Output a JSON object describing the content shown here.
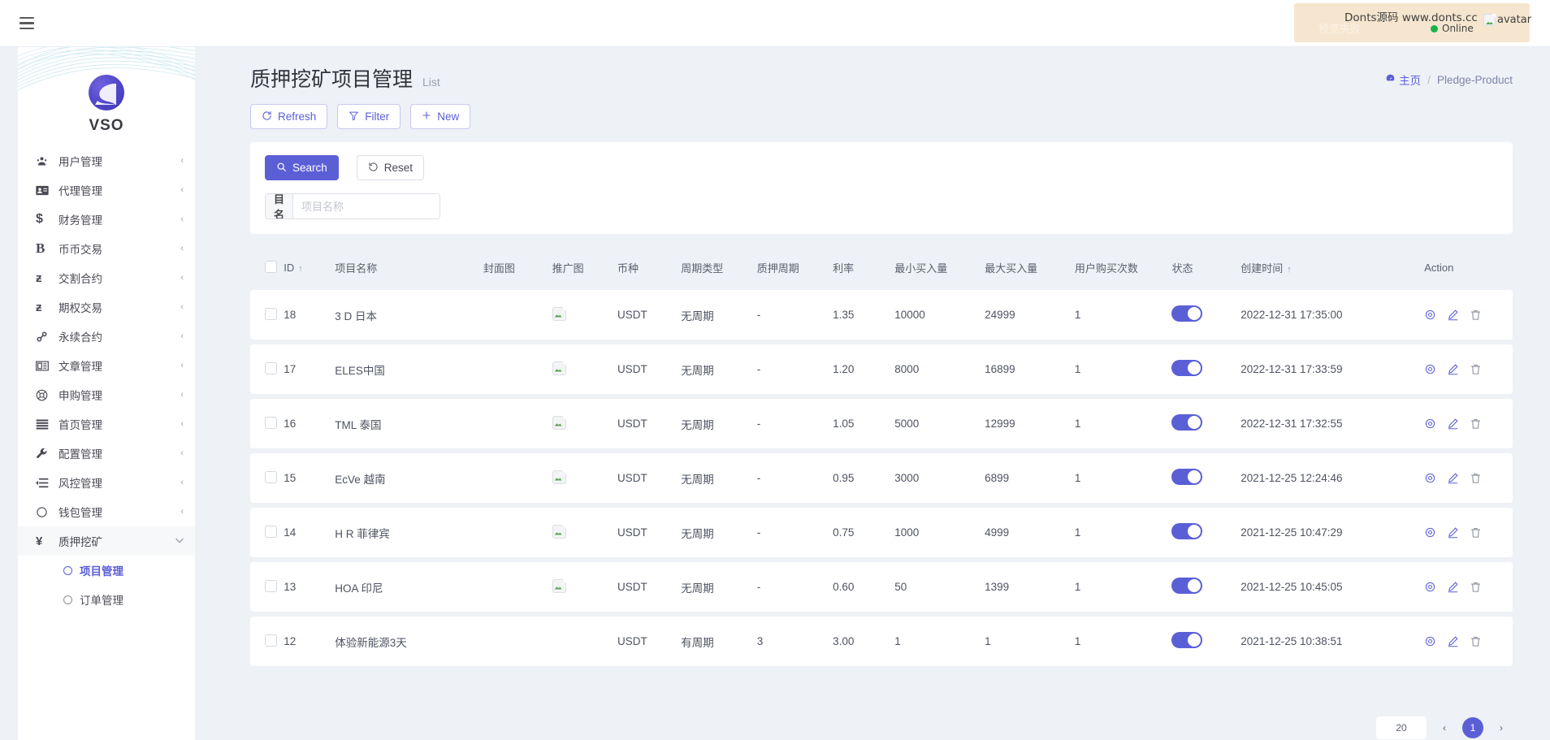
{
  "topbar": {
    "menu_toggle": "hamburger-menu",
    "notification_icon": "bell-icon",
    "theme_icon": "moon-icon"
  },
  "watermark": {
    "line1": "Donts源码 www.donts.cc",
    "fail_text": "预览失败",
    "online_label": "Online",
    "avatar_alt": "avatar"
  },
  "sidebar": {
    "brand": "VSO",
    "items": [
      {
        "label": "用户管理",
        "icon": "user-group-icon",
        "chevron": "‹"
      },
      {
        "label": "代理管理",
        "icon": "id-card-icon",
        "chevron": "‹"
      },
      {
        "label": "财务管理",
        "icon": "$",
        "chevron": "‹"
      },
      {
        "label": "币币交易",
        "icon": "B",
        "chevron": "‹"
      },
      {
        "label": "交割合约",
        "icon": "Ƀ",
        "chevron": "‹"
      },
      {
        "label": "期权交易",
        "icon": "Ƀ",
        "chevron": "‹"
      },
      {
        "label": "永续合约",
        "icon": "link-icon",
        "chevron": "‹"
      },
      {
        "label": "文章管理",
        "icon": "news-icon",
        "chevron": "‹"
      },
      {
        "label": "申购管理",
        "icon": "lifebuoy-icon",
        "chevron": "‹"
      },
      {
        "label": "首页管理",
        "icon": "lines-icon",
        "chevron": "‹"
      },
      {
        "label": "配置管理",
        "icon": "wrench-icon",
        "chevron": "‹"
      },
      {
        "label": "风控管理",
        "icon": "indent-icon",
        "chevron": "‹"
      },
      {
        "label": "钱包管理",
        "icon": "circle-icon",
        "chevron": "‹"
      }
    ],
    "active_group": {
      "label": "质押挖矿",
      "icon": "¥",
      "chevron": "⌄"
    },
    "submenu": [
      {
        "label": "项目管理",
        "current": true
      },
      {
        "label": "订单管理",
        "current": false
      }
    ]
  },
  "page": {
    "title": "质押挖矿项目管理",
    "subtitle": "List",
    "breadcrumb_home": "主页",
    "breadcrumb_sep": "/",
    "breadcrumb_current": "Pledge-Product"
  },
  "toolbar": {
    "refresh_label": "Refresh",
    "filter_label": "Filter",
    "new_label": "New"
  },
  "search_panel": {
    "search_label": "Search",
    "reset_label": "Reset",
    "field_label": "项目名称",
    "field_value": "",
    "field_placeholder": "项目名称"
  },
  "table": {
    "columns": [
      {
        "key": "cb",
        "label": "",
        "cls": "col-cb"
      },
      {
        "key": "id",
        "label": "ID",
        "cls": "col-id",
        "sort": "↑"
      },
      {
        "key": "name",
        "label": "项目名称",
        "cls": "col-name"
      },
      {
        "key": "cover",
        "label": "封面图",
        "cls": "col-cover"
      },
      {
        "key": "promo",
        "label": "推广图",
        "cls": "col-promo"
      },
      {
        "key": "coin",
        "label": "币种",
        "cls": "col-coin"
      },
      {
        "key": "cycle",
        "label": "周期类型",
        "cls": "col-cycle"
      },
      {
        "key": "period",
        "label": "质押周期",
        "cls": "col-period"
      },
      {
        "key": "rate",
        "label": "利率",
        "cls": "col-rate"
      },
      {
        "key": "min",
        "label": "最小买入量",
        "cls": "col-min"
      },
      {
        "key": "max",
        "label": "最大买入量",
        "cls": "col-max"
      },
      {
        "key": "times",
        "label": "用户购买次数",
        "cls": "col-times"
      },
      {
        "key": "status",
        "label": "状态",
        "cls": "col-status"
      },
      {
        "key": "time",
        "label": "创建时间",
        "cls": "col-time",
        "sort": "↑"
      },
      {
        "key": "action",
        "label": "Action",
        "cls": "col-action"
      }
    ],
    "rows": [
      {
        "id": "18",
        "name": "3 D 日本",
        "cover": "",
        "promo": "broken-image",
        "coin": "USDT",
        "cycle": "无周期",
        "period": "-",
        "rate": "1.35",
        "min": "10000",
        "max": "24999",
        "times": "1",
        "status": true,
        "time": "2022-12-31 17:35:00"
      },
      {
        "id": "17",
        "name": "ELES中国",
        "cover": "",
        "promo": "broken-image",
        "coin": "USDT",
        "cycle": "无周期",
        "period": "-",
        "rate": "1.20",
        "min": "8000",
        "max": "16899",
        "times": "1",
        "status": true,
        "time": "2022-12-31 17:33:59"
      },
      {
        "id": "16",
        "name": "TML 泰国",
        "cover": "",
        "promo": "broken-image",
        "coin": "USDT",
        "cycle": "无周期",
        "period": "-",
        "rate": "1.05",
        "min": "5000",
        "max": "12999",
        "times": "1",
        "status": true,
        "time": "2022-12-31 17:32:55"
      },
      {
        "id": "15",
        "name": "EcVe 越南",
        "cover": "",
        "promo": "broken-image",
        "coin": "USDT",
        "cycle": "无周期",
        "period": "-",
        "rate": "0.95",
        "min": "3000",
        "max": "6899",
        "times": "1",
        "status": true,
        "time": "2021-12-25 12:24:46"
      },
      {
        "id": "14",
        "name": "H R 菲律宾",
        "cover": "",
        "promo": "broken-image",
        "coin": "USDT",
        "cycle": "无周期",
        "period": "-",
        "rate": "0.75",
        "min": "1000",
        "max": "4999",
        "times": "1",
        "status": true,
        "time": "2021-12-25 10:47:29"
      },
      {
        "id": "13",
        "name": "HOA 印尼",
        "cover": "",
        "promo": "broken-image",
        "coin": "USDT",
        "cycle": "无周期",
        "period": "-",
        "rate": "0.60",
        "min": "50",
        "max": "1399",
        "times": "1",
        "status": true,
        "time": "2021-12-25 10:45:05"
      },
      {
        "id": "12",
        "name": "体验新能源3天",
        "cover": "",
        "promo": "",
        "coin": "USDT",
        "cycle": "有周期",
        "period": "3",
        "rate": "3.00",
        "min": "1",
        "max": "1",
        "times": "1",
        "status": true,
        "time": "2021-12-25 10:38:51"
      }
    ],
    "action_icons": [
      "eye-icon",
      "pencil-icon",
      "trash-icon"
    ]
  },
  "pagination": {
    "page_size": "20",
    "current_page": "1"
  },
  "colors": {
    "accent": "#5b5fd6",
    "page_bg": "#eef1f6",
    "panel_bg": "#ffffff",
    "online": "#19b34b",
    "watermark_bg": "#f6e6cf"
  }
}
